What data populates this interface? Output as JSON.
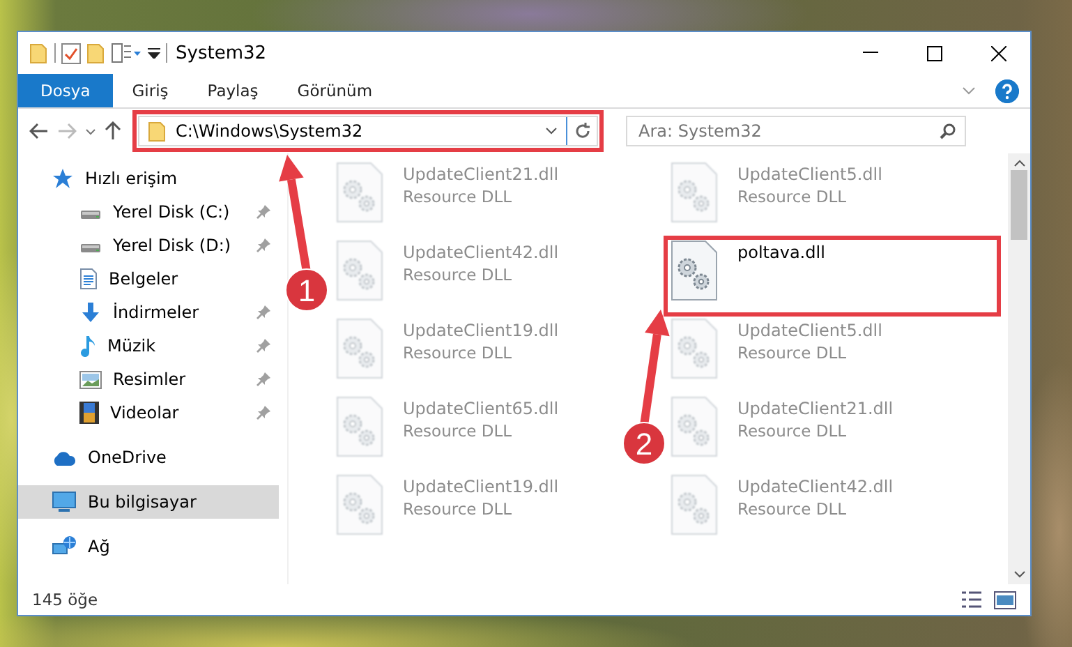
{
  "window": {
    "title": "System32"
  },
  "ribbon_tabs": [
    {
      "label": "Dosya",
      "selected": true
    },
    {
      "label": "Giriş",
      "selected": false
    },
    {
      "label": "Paylaş",
      "selected": false
    },
    {
      "label": "Görünüm",
      "selected": false
    }
  ],
  "address_bar": {
    "value": "C:\\Windows\\System32",
    "highlighted": true
  },
  "search": {
    "placeholder": "Ara: System32"
  },
  "sidebar": {
    "items": [
      {
        "label": "Hızlı erişim",
        "kind": "star",
        "selected": false,
        "children": [
          {
            "label": "Yerel Disk (C:)",
            "kind": "drive",
            "pinned": true,
            "selected": false
          },
          {
            "label": "Yerel Disk (D:)",
            "kind": "drive",
            "pinned": true,
            "selected": false
          },
          {
            "label": "Belgeler",
            "kind": "document",
            "pinned": false,
            "selected": false
          },
          {
            "label": "İndirmeler",
            "kind": "download",
            "pinned": true,
            "selected": false
          },
          {
            "label": "Müzik",
            "kind": "music",
            "pinned": true,
            "selected": false
          },
          {
            "label": "Resimler",
            "kind": "pictures",
            "pinned": true,
            "selected": false
          },
          {
            "label": "Videolar",
            "kind": "video",
            "pinned": true,
            "selected": false
          }
        ]
      },
      {
        "label": "OneDrive",
        "kind": "cloud",
        "selected": false
      },
      {
        "label": "Bu bilgisayar",
        "kind": "computer",
        "selected": true
      },
      {
        "label": "Ağ",
        "kind": "network",
        "selected": false
      }
    ]
  },
  "files": [
    {
      "name": "UpdateClient21.dll",
      "type": "Resource DLL",
      "blurred": true,
      "highlighted": false
    },
    {
      "name": "UpdateClient5.dll",
      "type": "Resource DLL",
      "blurred": true,
      "highlighted": false
    },
    {
      "name": "UpdateClient42.dll",
      "type": "Resource DLL",
      "blurred": true,
      "highlighted": false
    },
    {
      "name": "poltava.dll",
      "blurred": false,
      "highlighted": true
    },
    {
      "name": "UpdateClient19.dll",
      "type": "Resource DLL",
      "blurred": true,
      "highlighted": false
    },
    {
      "name": "UpdateClient5.dll",
      "type": "Resource DLL",
      "blurred": true,
      "highlighted": false
    },
    {
      "name": "UpdateClient65.dll",
      "type": "Resource DLL",
      "blurred": true,
      "highlighted": false
    },
    {
      "name": "UpdateClient21.dll",
      "type": "Resource DLL",
      "blurred": true,
      "highlighted": false
    },
    {
      "name": "UpdateClient19.dll",
      "type": "Resource DLL",
      "blurred": true,
      "highlighted": false
    },
    {
      "name": "UpdateClient42.dll",
      "type": "Resource DLL",
      "blurred": true,
      "highlighted": false
    }
  ],
  "status_bar": {
    "item_count": "145 öğe"
  },
  "annotations": [
    {
      "number": "1"
    },
    {
      "number": "2"
    }
  ]
}
